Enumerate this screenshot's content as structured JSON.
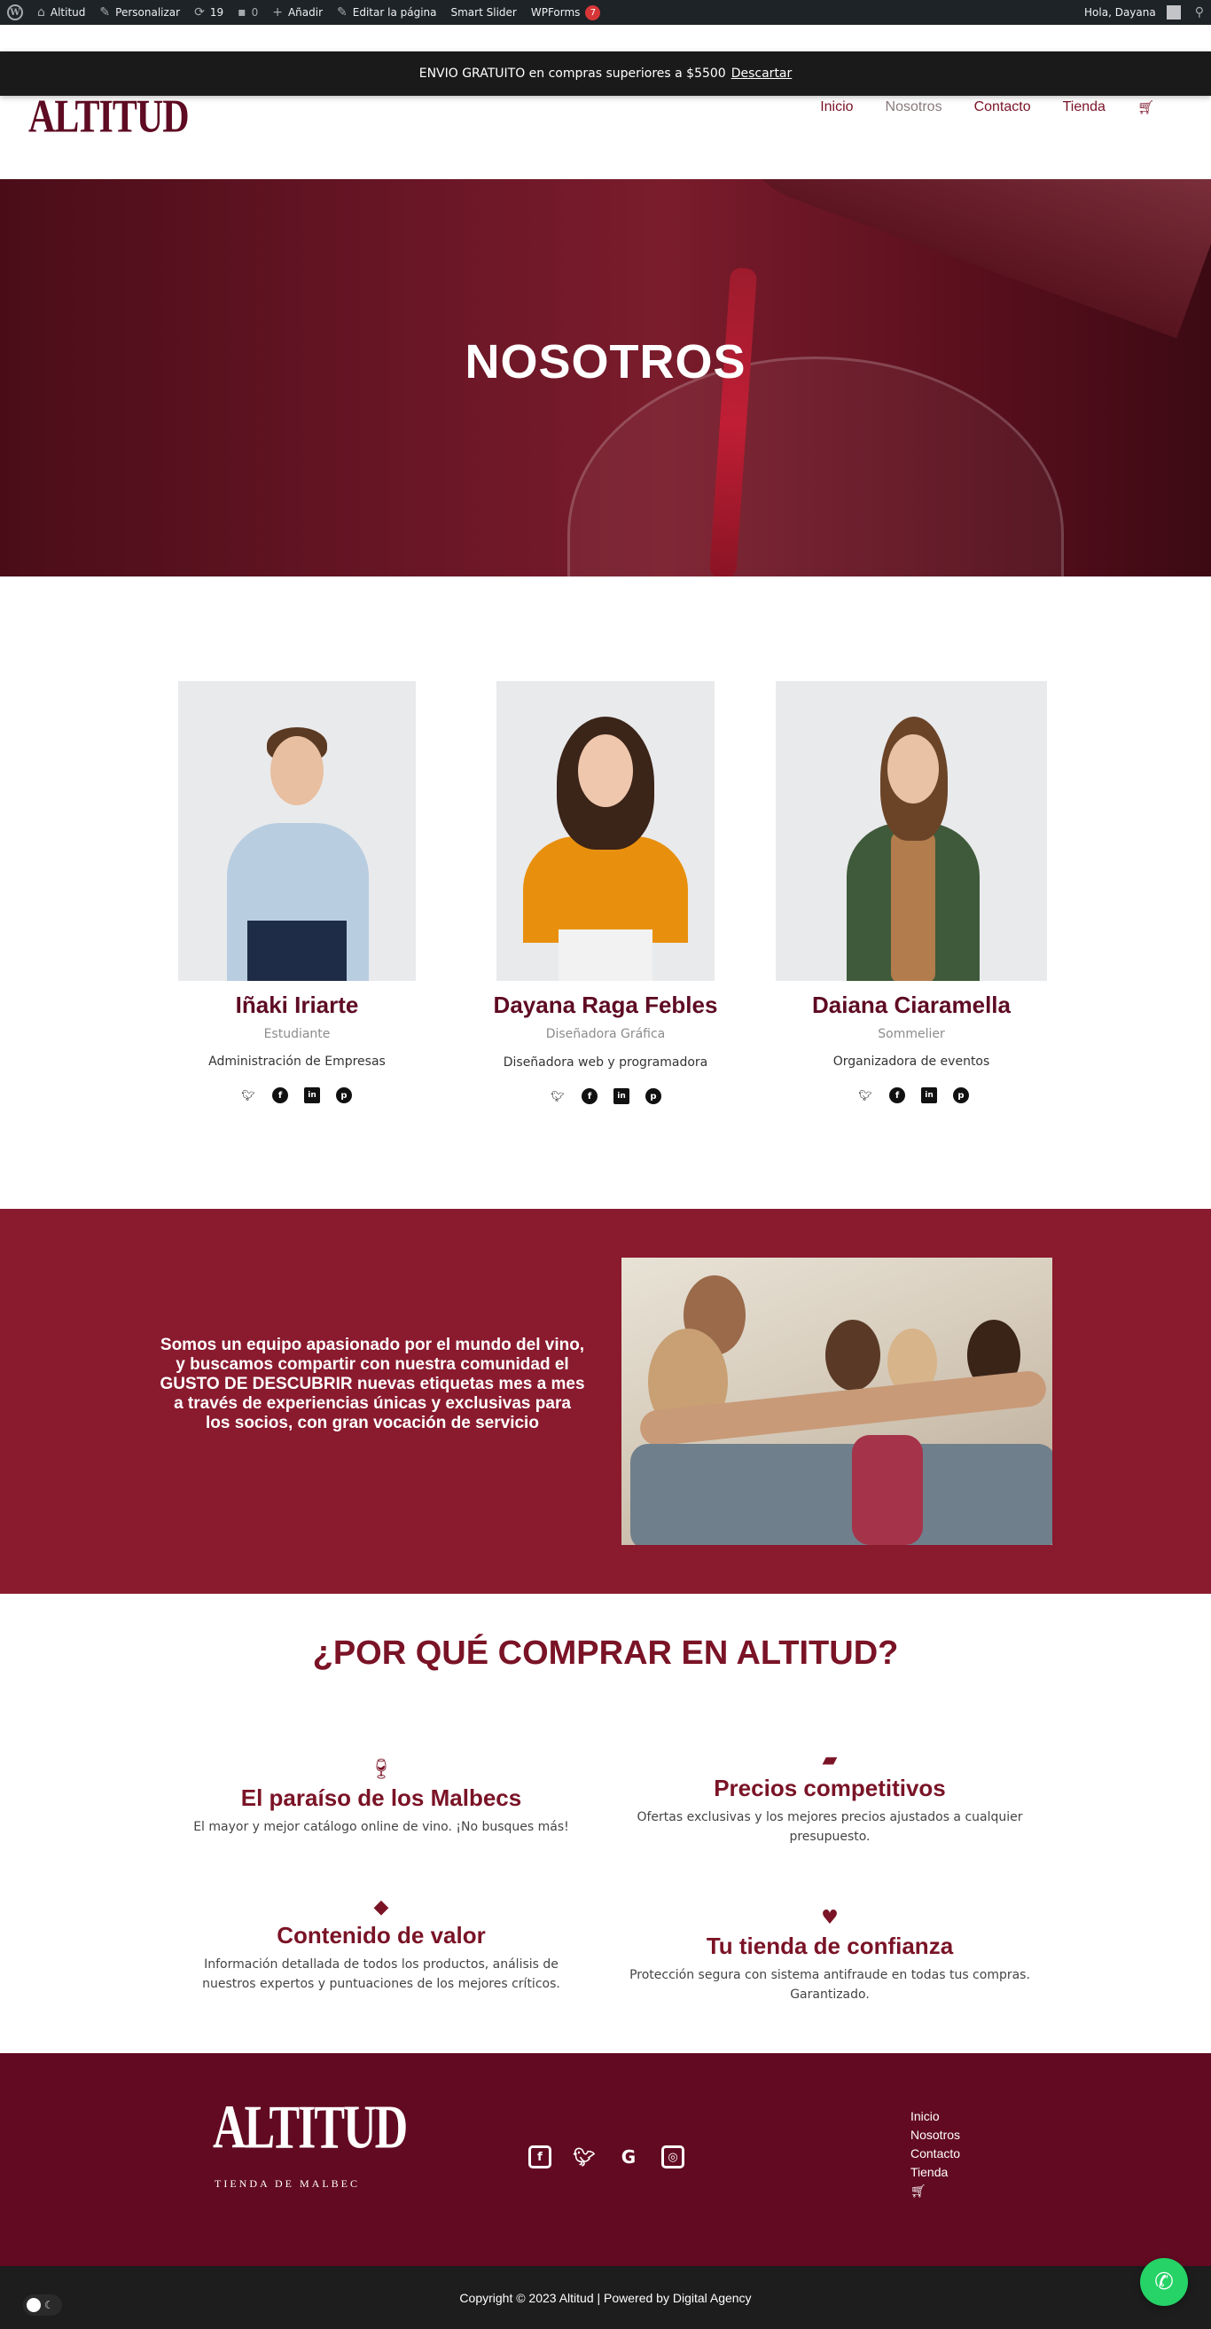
{
  "admin_bar": {
    "site": "Altitud",
    "customize": "Personalizar",
    "updates": "19",
    "comments": "0",
    "add_new": "Añadir",
    "edit_page": "Editar la página",
    "smart_slider": "Smart Slider",
    "wpforms": "WPForms",
    "wpforms_badge": "7",
    "greeting": "Hola, Dayana"
  },
  "notice": {
    "text": "ENVIO GRATUITO en compras superiores a $5500",
    "dismiss": "Descartar"
  },
  "header": {
    "logo": "ALTITUD",
    "nav": [
      {
        "label": "Inicio"
      },
      {
        "label": "Nosotros"
      },
      {
        "label": "Contacto"
      },
      {
        "label": "Tienda"
      }
    ],
    "cart_icon": "cart-icon"
  },
  "hero": {
    "title": "NOSOTROS"
  },
  "team": [
    {
      "name": "Iñaki Iriarte",
      "role": "Estudiante",
      "desc": "Administración de Empresas"
    },
    {
      "name": "Dayana Raga Febles",
      "role": "Diseñadora Gráfica",
      "desc": "Diseñadora web y programadora"
    },
    {
      "name": "Daiana Ciaramella",
      "role": "Sommelier",
      "desc": "Organizadora de eventos"
    }
  ],
  "social_icons": [
    "twitter-icon",
    "facebook-icon",
    "linkedin-icon",
    "pinterest-icon"
  ],
  "band": {
    "text": "Somos un equipo apasionado por el mundo del vino, y buscamos compartir con nuestra comunidad el GUSTO DE DESCUBRIR nuevas etiquetas mes a mes a través de experiencias únicas y exclusivas para los socios, con gran vocación de servicio"
  },
  "why": {
    "title": "¿POR QUÉ COMPRAR EN ALTITUD?",
    "features": [
      {
        "icon": "wine-glass-icon",
        "title": "El paraíso de los Malbecs",
        "text": "El mayor y mejor catálogo online de vino. ¡No busques más!"
      },
      {
        "icon": "wallet-icon",
        "title": "Precios competitivos",
        "text": "Ofertas exclusivas y los mejores precios ajustados a cualquier presupuesto."
      },
      {
        "icon": "diamond-icon",
        "title": "Contenido de valor",
        "text": "Información detallada de todos los productos, análisis de nuestros expertos y puntuaciones de los mejores críticos."
      },
      {
        "icon": "heart-check-icon",
        "title": "Tu tienda de confianza",
        "text": "Protección segura con sistema antifraude en todas tus compras. Garantizado."
      }
    ]
  },
  "footer": {
    "logo": "ALTITUD",
    "tagline": "TIENDA DE MALBEC",
    "nav": [
      "Inicio",
      "Nosotros",
      "Contacto",
      "Tienda"
    ],
    "copyright": "Copyright © 2023 Altitud | Powered by Digital Agency"
  },
  "colors": {
    "brand": "#7a1326",
    "band": "#8a1a2e",
    "footer": "#620a22"
  }
}
